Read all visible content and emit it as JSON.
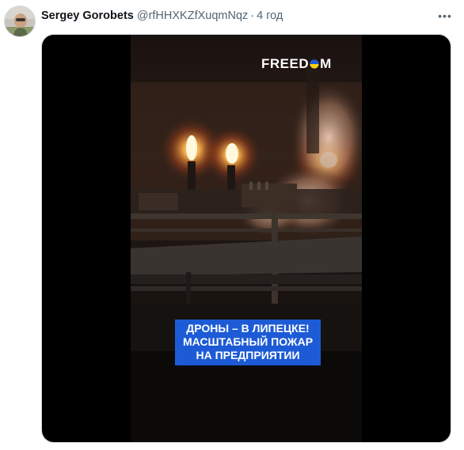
{
  "tweet": {
    "author_name": "Sergey Gorobets",
    "handle": "@rfHHXKZfXuqmNqz",
    "separator": "·",
    "time": "4 год",
    "more_icon": "more-horizontal-icon"
  },
  "video": {
    "logo_text_left": "FREED",
    "logo_text_right": "M",
    "caption_lines": [
      "ДРОНЫ – В ЛИПЕЦКЕ!",
      "МАСШТАБНЫЙ ПОЖАР",
      "НА ПРЕДПРИЯТИИ"
    ]
  },
  "colors": {
    "caption_bg": "#1d5bd6",
    "flag_blue": "#1e5bd8",
    "flag_yellow": "#f5d10a",
    "name": "#0f1419",
    "secondary_text": "#536471"
  }
}
